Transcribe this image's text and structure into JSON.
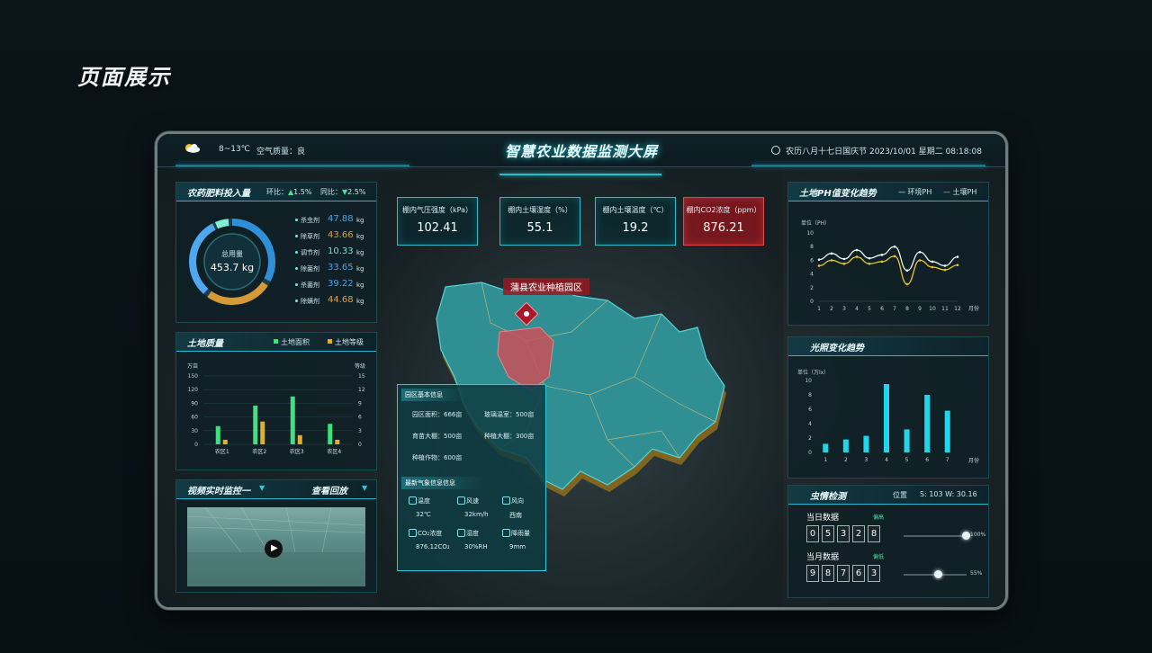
{
  "page_heading": "页面展示",
  "header": {
    "temperature": "8~13℃",
    "air_quality": "空气质量：良",
    "title": "智慧农业数据监测大屏",
    "datetime": "农历八月十七日国庆节   2023/10/01  星期二   08:18:08"
  },
  "fertilizer": {
    "title": "农药肥料投入量",
    "yoy_label": "环比：",
    "yoy_value": "1.5%",
    "mom_label": "同比：",
    "mom_value": "2.5%",
    "center_label": "总用量",
    "center_value": "453.7 kg",
    "items": [
      {
        "name": "杀虫剂",
        "value": "47.88",
        "unit": "kg",
        "color": "#3fa9f5"
      },
      {
        "name": "除草剂",
        "value": "43.66",
        "unit": "kg",
        "color": "#e0a23a"
      },
      {
        "name": "调节剂",
        "value": "10.33",
        "unit": "kg",
        "color": "#72e6c8"
      },
      {
        "name": "除菌剂",
        "value": "33.65",
        "unit": "kg",
        "color": "#3fa9f5"
      },
      {
        "name": "杀菌剂",
        "value": "39.22",
        "unit": "kg",
        "color": "#3fa9f5"
      },
      {
        "name": "除螨剂",
        "value": "44.68",
        "unit": "kg",
        "color": "#e0a23a"
      }
    ]
  },
  "land": {
    "title": "土地质量",
    "legend_area": "土地面积",
    "legend_grade": "土地等级",
    "left_unit": "万亩",
    "right_unit": "等级"
  },
  "land_chart": {
    "chart_data": {
      "type": "bar",
      "categories": [
        "农区1",
        "农区2",
        "农区3",
        "农区4"
      ],
      "series": [
        {
          "name": "土地面积",
          "values": [
            40,
            85,
            105,
            45
          ]
        },
        {
          "name": "土地等级",
          "values": [
            1,
            5,
            2,
            1
          ]
        }
      ],
      "y_left": {
        "ticks": [
          "150",
          "120",
          "90",
          "60",
          "30",
          "0"
        ],
        "range": [
          0,
          150
        ]
      },
      "y_right": {
        "ticks": [
          "15",
          "12",
          "9",
          "6",
          "3",
          "0"
        ],
        "range": [
          0,
          15
        ]
      }
    }
  },
  "video": {
    "title": "视频实时监控一",
    "link": "查看回放"
  },
  "metrics": [
    {
      "label": "棚内气压强度（kPa）",
      "value": "102.41",
      "alert": false
    },
    {
      "label": "棚内土壤湿度（%）",
      "value": "55.1",
      "alert": false
    },
    {
      "label": "棚内土壤温度（℃）",
      "value": "19.2",
      "alert": false
    },
    {
      "label": "棚内CO2浓度（ppm）",
      "value": "876.21",
      "alert": true
    }
  ],
  "map": {
    "region_label": "蒲县农业种植园区"
  },
  "park_info": {
    "title": "园区基本信息",
    "rows": [
      [
        "园区面积：666亩",
        "玻璃温室：500亩"
      ],
      [
        "育苗大棚：500亩",
        "种植大棚：300亩"
      ],
      [
        "种植作物：600亩",
        ""
      ]
    ],
    "weather_title": "最新气象信息信息",
    "weather": [
      {
        "label": "温度",
        "value": "32℃"
      },
      {
        "label": "风速",
        "value": "32km/h"
      },
      {
        "label": "风向",
        "value": "西南"
      },
      {
        "label": "CO₂浓度",
        "value": "876.12CO₂"
      },
      {
        "label": "湿度",
        "value": "30%RH"
      },
      {
        "label": "降雨量",
        "value": "9mm"
      }
    ]
  },
  "ph": {
    "title": "土地PH值变化趋势",
    "legend_env": "环境PH",
    "legend_soil": "土壤PH",
    "unit": "单位（PH）",
    "x_unit": "月份"
  },
  "ph_chart": {
    "chart_data": {
      "type": "line",
      "x": [
        "1",
        "2",
        "3",
        "4",
        "5",
        "6",
        "7",
        "8",
        "9",
        "10",
        "11",
        "12"
      ],
      "series": [
        {
          "name": "环境PH",
          "values": [
            6.1,
            7.0,
            6.2,
            7.5,
            6.3,
            6.8,
            8.0,
            4.5,
            7.2,
            5.8,
            5.2,
            6.5
          ],
          "color": "#e8f4f6"
        },
        {
          "name": "土壤PH",
          "values": [
            5.2,
            6.0,
            5.5,
            6.5,
            5.5,
            5.8,
            6.6,
            2.5,
            6.0,
            5.0,
            4.6,
            5.3
          ],
          "color": "#e6c531"
        }
      ],
      "ylim": [
        0,
        10
      ],
      "yticks": [
        "10",
        "8",
        "6",
        "4",
        "2",
        "0"
      ],
      "ylabel": "单位（PH）",
      "xlabel": "月份"
    }
  },
  "light": {
    "title": "光照变化趋势",
    "unit": "单位（万lx）",
    "x_unit": "月份"
  },
  "light_chart": {
    "chart_data": {
      "type": "bar",
      "categories": [
        "1",
        "2",
        "3",
        "4",
        "5",
        "6",
        "7"
      ],
      "values": [
        1.2,
        1.8,
        2.3,
        9.5,
        3.2,
        8.0,
        5.8
      ],
      "ylim": [
        0,
        10
      ],
      "yticks": [
        "10",
        "8",
        "6",
        "4",
        "2",
        "0"
      ],
      "ylabel": "单位（万lx）",
      "xlabel": "月份"
    }
  },
  "pest": {
    "title": "虫情检测",
    "position_label": "位置",
    "position_value": "S: 103   W: 30.16",
    "today_label": "当日数据",
    "today_status": "偏高",
    "today_digits": [
      "0",
      "5",
      "3",
      "2",
      "8"
    ],
    "today_percent": "100%",
    "today_level": 1.0,
    "month_label": "当月数据",
    "month_status": "偏低",
    "month_digits": [
      "9",
      "8",
      "7",
      "6",
      "3"
    ],
    "month_percent": "55%",
    "month_level": 0.55
  }
}
